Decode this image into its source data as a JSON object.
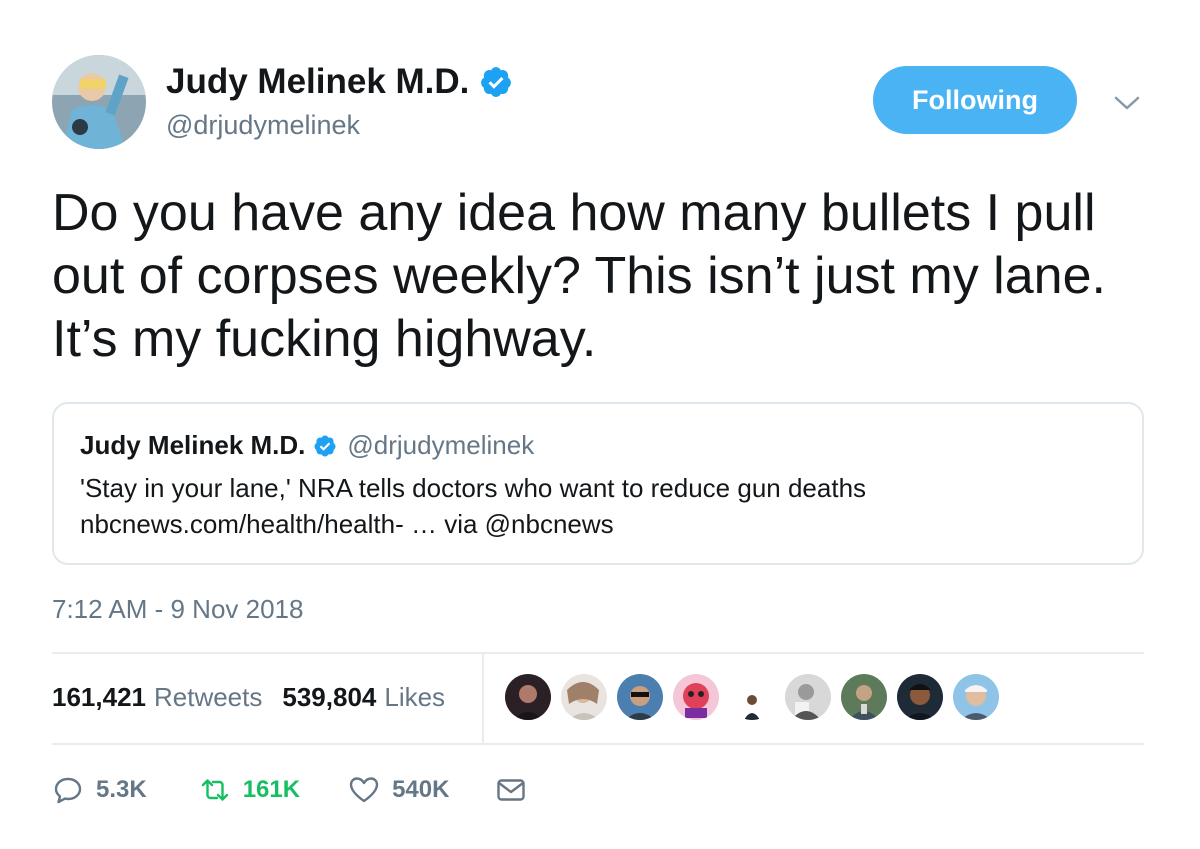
{
  "author": {
    "name": "Judy Melinek M.D.",
    "handle": "@drjudymelinek",
    "verified": true
  },
  "follow_button": {
    "label": "Following",
    "color": "#4ab3f4"
  },
  "tweet": {
    "text": "Do you have any idea how many bullets I pull out of corpses weekly? This isn’t just my lane. It’s my fucking highway."
  },
  "quoted_tweet": {
    "name": "Judy Melinek M.D.",
    "handle": "@drjudymelinek",
    "line1": "'Stay in your lane,' NRA tells doctors who want to reduce gun deaths",
    "line2": "nbcnews.com/health/health- … via @nbcnews"
  },
  "timestamp": "7:12 AM - 9 Nov 2018",
  "stats": {
    "retweets_count": "161,421",
    "retweets_label": "Retweets",
    "likes_count": "539,804",
    "likes_label": "Likes"
  },
  "liker_avatars": [
    {
      "name": "liker-1"
    },
    {
      "name": "liker-2"
    },
    {
      "name": "liker-3"
    },
    {
      "name": "liker-4"
    },
    {
      "name": "liker-5"
    },
    {
      "name": "liker-6"
    },
    {
      "name": "liker-7"
    },
    {
      "name": "liker-8"
    },
    {
      "name": "liker-9"
    }
  ],
  "actions": {
    "reply": {
      "icon": "reply-icon",
      "count": "5.3K",
      "color": "#657786"
    },
    "retweet": {
      "icon": "retweet-icon",
      "count": "161K",
      "color": "#17bf63"
    },
    "like": {
      "icon": "heart-icon",
      "count": "540K",
      "color": "#657786"
    },
    "message": {
      "icon": "envelope-icon"
    }
  },
  "colors": {
    "text": "#14171a",
    "secondary": "#657786",
    "verified": "#1da1f2",
    "retweet_green": "#17bf63",
    "border": "#e1e8ed"
  }
}
